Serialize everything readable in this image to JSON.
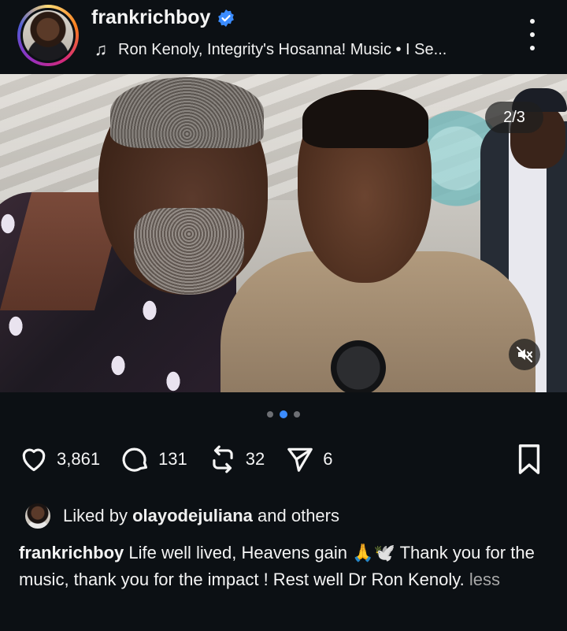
{
  "post": {
    "username": "frankrichboy",
    "verified": true,
    "audio": "Ron Kenoly, Integrity's Hosanna! Music • I Se...",
    "image_counter": "2/3",
    "carousel": {
      "total": 3,
      "current": 2
    }
  },
  "actions": {
    "likes": "3,861",
    "comments": "131",
    "reposts": "32",
    "shares": "6"
  },
  "liked_by": {
    "prefix": "Liked by",
    "user": "olayodejuliana",
    "suffix": "and others"
  },
  "caption": {
    "user": "frankrichboy",
    "text": "Life well lived, Heavens gain 🙏🕊️ Thank you for the music, thank you for the impact !  Rest well Dr  Ron Kenoly.",
    "toggle": "less"
  },
  "icons": {
    "verified": "verified-badge-icon",
    "music": "music-note-icon",
    "more": "more-vertical-icon",
    "like": "heart-icon",
    "comment": "comment-bubble-icon",
    "repost": "repost-icon",
    "share": "send-icon",
    "save": "bookmark-icon",
    "mute": "speaker-muted-icon"
  },
  "colors": {
    "background": "#0c1014",
    "text": "#f5f5f5",
    "verified": "#3b8cff",
    "active_dot": "#3b8cff",
    "muted_text": "#a8a8a8"
  }
}
